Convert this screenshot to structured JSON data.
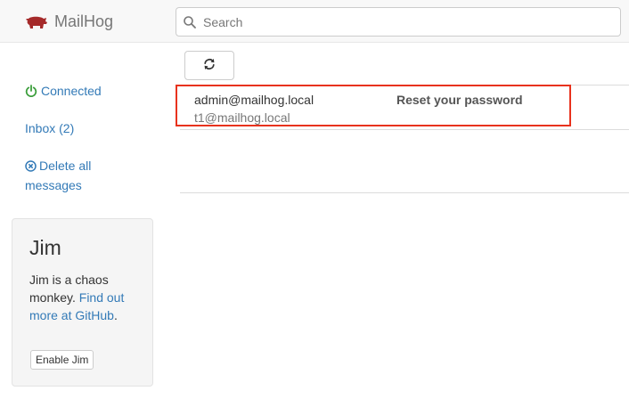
{
  "app": {
    "name": "MailHog",
    "logo_icon": "pig-icon",
    "brand_color": "#a52a2a"
  },
  "search": {
    "placeholder": "Search",
    "value": "",
    "icon": "search-icon"
  },
  "sidebar": {
    "connection_status": "Connected",
    "connection_color": "#3c9e3c",
    "inbox_label": "Inbox (2)",
    "delete_label": "Delete all messages"
  },
  "jim": {
    "title": "Jim",
    "description": "Jim is a chaos monkey.",
    "link_text": "Find out more at GitHub",
    "link_suffix": ".",
    "button_label": "Enable Jim"
  },
  "toolbar": {
    "refresh_icon": "refresh-icon"
  },
  "messages": [
    {
      "from": "admin@mailhog.local",
      "to": "t1@mailhog.local",
      "subject": "Reset your password"
    }
  ],
  "colors": {
    "link": "#337ab7",
    "highlight_border": "#e8321d"
  }
}
